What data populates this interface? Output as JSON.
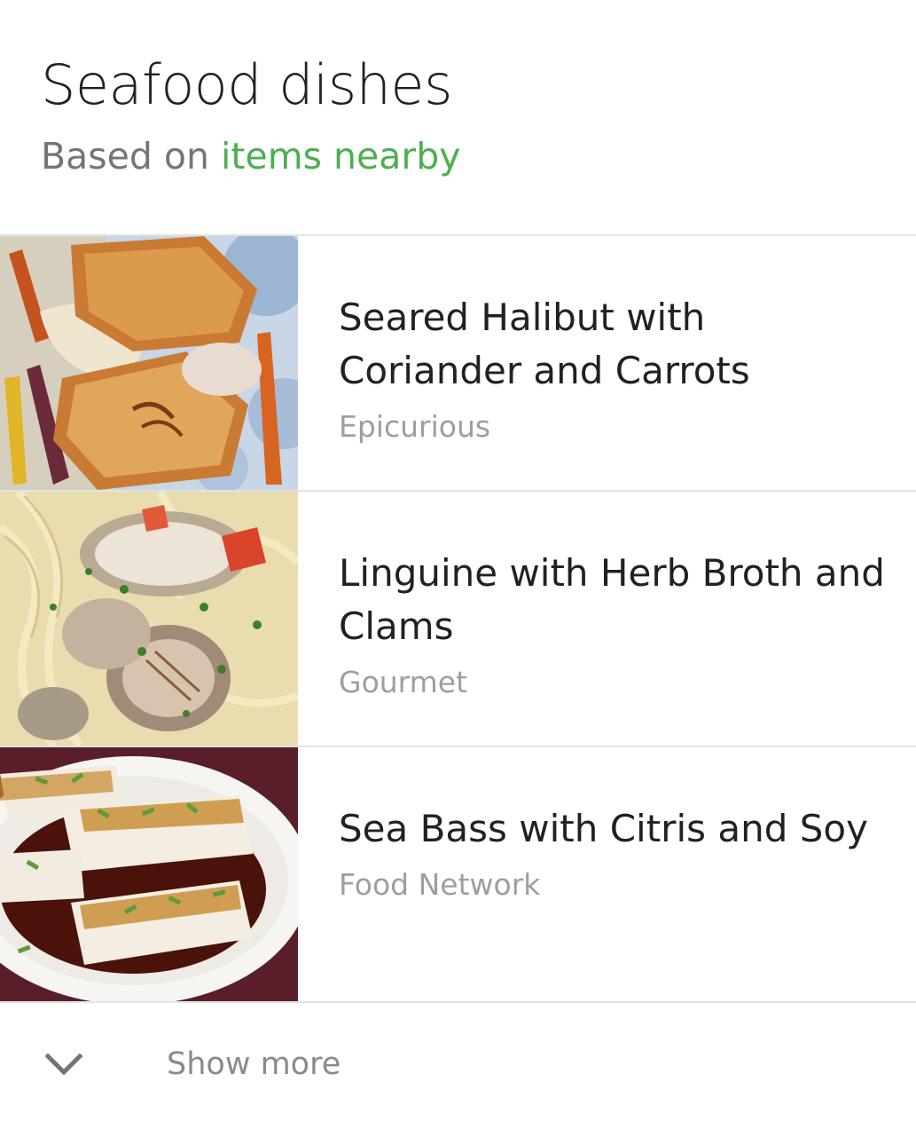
{
  "card": {
    "title": "Seafood dishes",
    "subtitle_prefix": "Based on ",
    "subtitle_link": "items nearby",
    "link_color": "#4caf50"
  },
  "dishes": [
    {
      "title": "Seared Halibut with Coriander and Carrots",
      "source": "Epicurious",
      "image_icon": "halibut-photo"
    },
    {
      "title": "Linguine with Herb Broth and Clams",
      "source": "Gourmet",
      "image_icon": "linguine-clams-photo"
    },
    {
      "title": "Sea Bass with Citris and Soy",
      "source": "Food Network",
      "image_icon": "sea-bass-photo"
    }
  ],
  "footer": {
    "show_more_label": "Show more",
    "icon": "chevron-down-icon"
  }
}
